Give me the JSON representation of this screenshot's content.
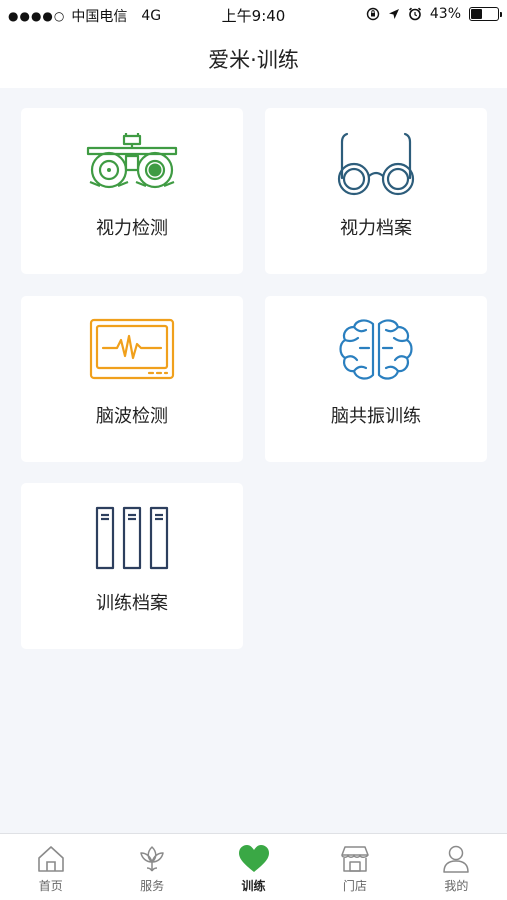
{
  "status_bar": {
    "signal": "●●●●○",
    "carrier": "中国电信",
    "network": "4G",
    "time": "上午9:40",
    "battery_percent": "43%",
    "battery_level": 0.43
  },
  "header": {
    "title": "爱米·训练"
  },
  "cards": [
    {
      "label": "视力检测",
      "icon": "phoropter-icon",
      "color": "#3f9b43"
    },
    {
      "label": "视力档案",
      "icon": "glasses-icon",
      "color": "#2d5d7b"
    },
    {
      "label": "脑波检测",
      "icon": "monitor-heartbeat-icon",
      "color": "#f0a01c"
    },
    {
      "label": "脑共振训练",
      "icon": "brain-icon",
      "color": "#2a7fbf"
    },
    {
      "label": "训练档案",
      "icon": "binders-icon",
      "color": "#2d3f5e"
    }
  ],
  "tab_bar": {
    "active": "训练",
    "active_color": "#3aa845",
    "tabs": [
      {
        "label": "首页",
        "icon": "home-icon"
      },
      {
        "label": "服务",
        "icon": "lotus-icon"
      },
      {
        "label": "训练",
        "icon": "heart-icon"
      },
      {
        "label": "门店",
        "icon": "store-icon"
      },
      {
        "label": "我的",
        "icon": "user-icon"
      }
    ]
  }
}
